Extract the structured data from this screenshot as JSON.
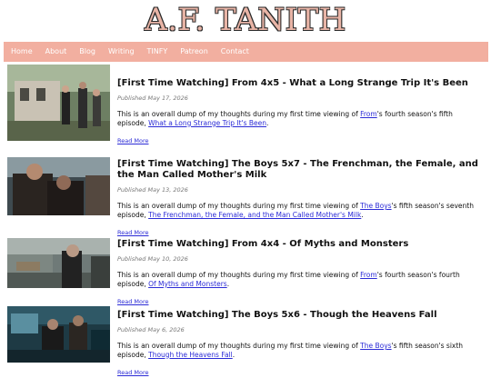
{
  "site": {
    "logo": "A.F. TANITH"
  },
  "nav": {
    "items": [
      "Home",
      "About",
      "Blog",
      "Writing",
      "TINFY",
      "Patreon",
      "Contact"
    ]
  },
  "posts": [
    {
      "title": "[First Time Watching] From 4x5 - What a Long Strange Trip It's Been",
      "date": "Published May 17, 2026",
      "excerpt_pre": "This is an overall dump of my thoughts during my first time viewing of ",
      "show": "From",
      "excerpt_mid": "'s fourth season's fifth episode, ",
      "episode_link": "What a Long Strange Trip It's Been",
      "excerpt_post": ".",
      "read_more": "Read More"
    },
    {
      "title": "[First Time Watching] The Boys 5x7 - The Frenchman, the Female, and the Man Called Mother's Milk",
      "date": "Published May 13, 2026",
      "excerpt_pre": "This is an overall dump of my thoughts during my first time viewing of ",
      "show": "The Boys",
      "excerpt_mid": "'s fifth season's seventh episode, ",
      "episode_link": "The Frenchman, the Female, and the Man Called Mother's Milk",
      "excerpt_post": ".",
      "read_more": "Read More"
    },
    {
      "title": "[First Time Watching] From 4x4 - Of Myths and Monsters",
      "date": "Published May 10, 2026",
      "excerpt_pre": "This is an overall dump of my thoughts during my first time viewing of ",
      "show": "From",
      "excerpt_mid": "'s fourth season's fourth episode, ",
      "episode_link": "Of Myths and Monsters",
      "excerpt_post": ".",
      "read_more": "Read More"
    },
    {
      "title": "[First Time Watching] The Boys 5x6 - Though the Heavens Fall",
      "date": "Published May 6, 2026",
      "excerpt_pre": "This is an overall dump of my thoughts during my first time viewing of ",
      "show": "The Boys",
      "excerpt_mid": "'s fifth season's sixth episode, ",
      "episode_link": "Though the Heavens Fall",
      "excerpt_post": ".",
      "read_more": "Read More"
    }
  ]
}
